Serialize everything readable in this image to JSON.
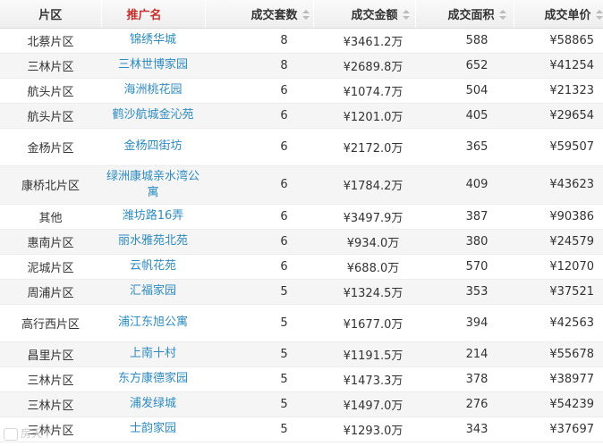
{
  "headers": {
    "district": "片区",
    "project": "推广名",
    "units": "成交套数",
    "amount": "成交金额",
    "area": "成交面积",
    "price": "成交单价"
  },
  "colors": {
    "project_header": "#c9302c",
    "link": "#2e8bc0",
    "row_stripe": "#f5f5f5"
  },
  "rows": [
    {
      "district": "北蔡片区",
      "project": "锦绣华城",
      "units": "8",
      "amount": "¥3461.2万",
      "area": "588",
      "price": "¥58865"
    },
    {
      "district": "三林片区",
      "project": "三林世博家园",
      "units": "8",
      "amount": "¥2689.8万",
      "area": "652",
      "price": "¥41254"
    },
    {
      "district": "航头片区",
      "project": "海洲桃花园",
      "units": "6",
      "amount": "¥1074.7万",
      "area": "504",
      "price": "¥21323"
    },
    {
      "district": "航头片区",
      "project": "鹤沙航城金沁苑",
      "units": "6",
      "amount": "¥1201.0万",
      "area": "405",
      "price": "¥29654"
    },
    {
      "district": "金杨片区",
      "project": "金杨四街坊",
      "units": "6",
      "amount": "¥2172.0万",
      "area": "365",
      "price": "¥59507"
    },
    {
      "district": "康桥北片区",
      "project": "绿洲康城亲水湾公寓",
      "units": "6",
      "amount": "¥1784.2万",
      "area": "409",
      "price": "¥43623"
    },
    {
      "district": "其他",
      "project": "潍坊路16弄",
      "units": "6",
      "amount": "¥3497.9万",
      "area": "387",
      "price": "¥90386"
    },
    {
      "district": "惠南片区",
      "project": "丽水雅苑北苑",
      "units": "6",
      "amount": "¥934.0万",
      "area": "380",
      "price": "¥24579"
    },
    {
      "district": "泥城片区",
      "project": "云帆花苑",
      "units": "6",
      "amount": "¥688.0万",
      "area": "570",
      "price": "¥12070"
    },
    {
      "district": "周浦片区",
      "project": "汇福家园",
      "units": "5",
      "amount": "¥1324.5万",
      "area": "353",
      "price": "¥37521"
    },
    {
      "district": "高行西片区",
      "project": "浦江东旭公寓",
      "units": "5",
      "amount": "¥1677.0万",
      "area": "394",
      "price": "¥42563"
    },
    {
      "district": "昌里片区",
      "project": "上南十村",
      "units": "5",
      "amount": "¥1191.5万",
      "area": "214",
      "price": "¥55678"
    },
    {
      "district": "三林片区",
      "project": "东方康德家园",
      "units": "5",
      "amount": "¥1473.3万",
      "area": "378",
      "price": "¥38977"
    },
    {
      "district": "三林片区",
      "project": "浦发绿城",
      "units": "5",
      "amount": "¥1497.0万",
      "area": "276",
      "price": "¥54239"
    },
    {
      "district": "三林片区",
      "project": "士韵家园",
      "units": "5",
      "amount": "¥1293.0万",
      "area": "343",
      "price": "¥37697"
    }
  ],
  "watermark": {
    "text": "房天下"
  }
}
